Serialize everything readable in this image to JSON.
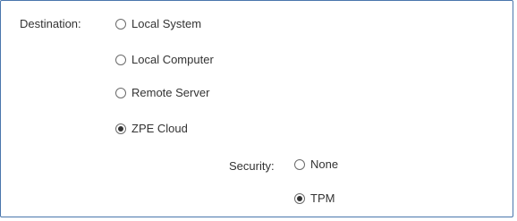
{
  "destination": {
    "label": "Destination:",
    "options": [
      {
        "label": "Local System",
        "checked": false
      },
      {
        "label": "Local Computer",
        "checked": false
      },
      {
        "label": "Remote Server",
        "checked": false
      },
      {
        "label": "ZPE Cloud",
        "checked": true
      }
    ]
  },
  "security": {
    "label": "Security:",
    "options": [
      {
        "label": "None",
        "checked": false
      },
      {
        "label": "TPM",
        "checked": true
      }
    ]
  }
}
